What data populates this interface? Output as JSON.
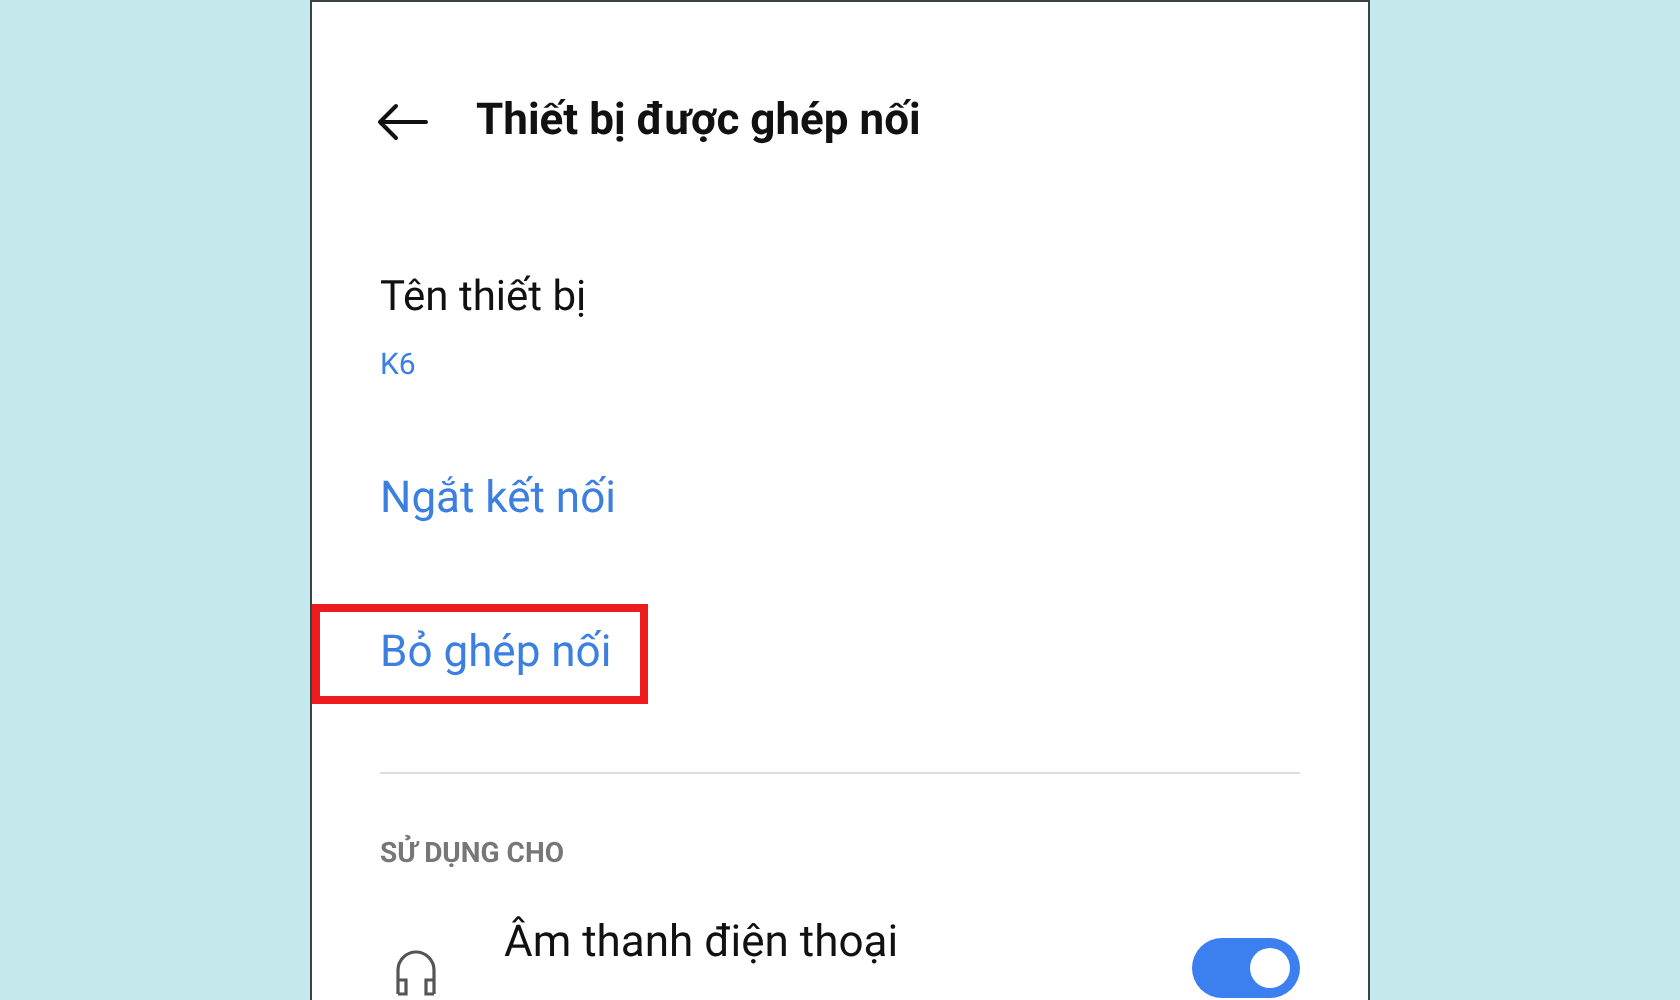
{
  "header": {
    "title": "Thiết bị được ghép nối"
  },
  "device_name": {
    "label": "Tên thiết bị",
    "value": "K6"
  },
  "actions": [
    {
      "label": "Ngắt kết nối",
      "highlighted": false
    },
    {
      "label": "Bỏ ghép nối",
      "highlighted": true
    }
  ],
  "section": {
    "title": "SỬ DỤNG CHO"
  },
  "uses": [
    {
      "label": "Âm thanh điện thoại",
      "on": true
    }
  ]
}
